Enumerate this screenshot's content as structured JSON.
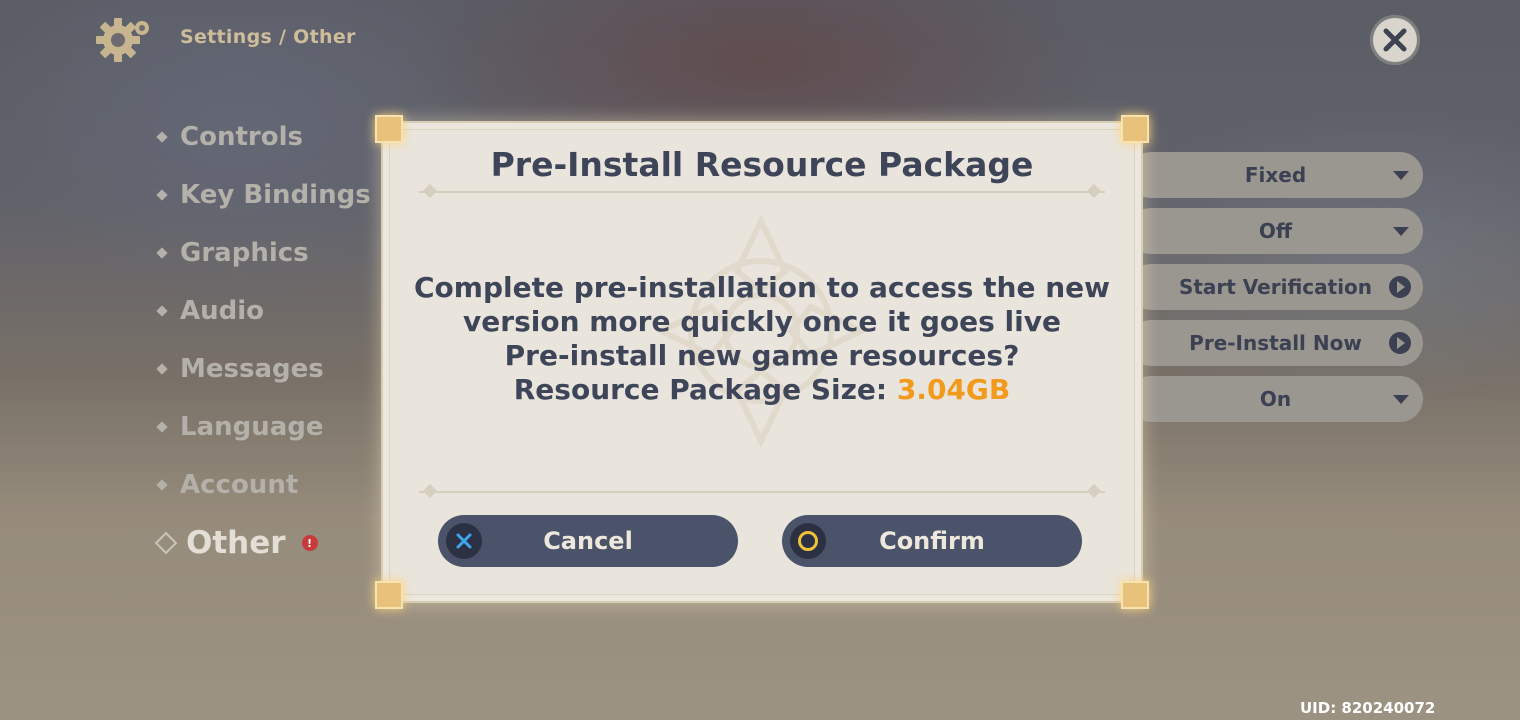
{
  "header": {
    "breadcrumb": "Settings / Other",
    "settings_icon": "gear-icon",
    "close_icon": "close-icon"
  },
  "menu": {
    "items": [
      {
        "label": "Controls",
        "active": false
      },
      {
        "label": "Key Bindings",
        "active": false
      },
      {
        "label": "Graphics",
        "active": false
      },
      {
        "label": "Audio",
        "active": false
      },
      {
        "label": "Messages",
        "active": false
      },
      {
        "label": "Language",
        "active": false
      },
      {
        "label": "Account",
        "active": false
      },
      {
        "label": "Other",
        "active": true
      }
    ],
    "other_alert": "!"
  },
  "settings": {
    "values": [
      "Fixed",
      "Off",
      "Start Verification",
      "Pre-Install Now",
      "On"
    ]
  },
  "dialog": {
    "title": "Pre-Install Resource Package",
    "line1": "Complete pre-installation to access the new",
    "line2": "version more quickly once it goes live",
    "line3": "Pre-install new game resources?",
    "size_label": "Resource Package Size:",
    "size_value": "3.04GB",
    "cancel_label": "Cancel",
    "confirm_label": "Confirm",
    "accent_color": "#f29a1c"
  },
  "footer": {
    "uid": "UID: 820240072"
  }
}
